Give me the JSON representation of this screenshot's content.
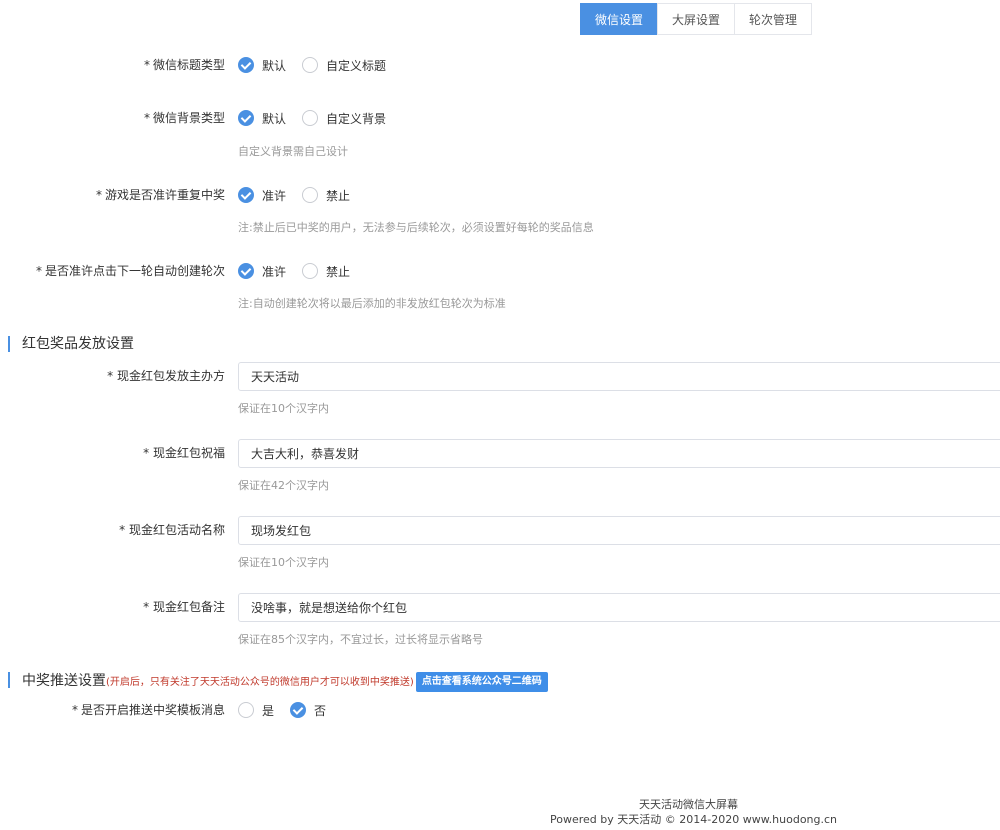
{
  "tabs": [
    {
      "label": "微信设置",
      "active": true
    },
    {
      "label": "大屏设置",
      "active": false
    },
    {
      "label": "轮次管理",
      "active": false
    }
  ],
  "settings": [
    {
      "label": "微信标题类型",
      "options": [
        "默认",
        "自定义标题"
      ],
      "selected": 0
    },
    {
      "label": "微信背景类型",
      "options": [
        "默认",
        "自定义背景"
      ],
      "selected": 0,
      "hint": "自定义背景需自己设计"
    },
    {
      "label": "游戏是否准许重复中奖",
      "options": [
        "准许",
        "禁止"
      ],
      "selected": 0,
      "hint": "注:禁止后已中奖的用户，无法参与后续轮次，必须设置好每轮的奖品信息"
    },
    {
      "label": "是否准许点击下一轮自动创建轮次",
      "options": [
        "准许",
        "禁止"
      ],
      "selected": 0,
      "hint": "注:自动创建轮次将以最后添加的非发放红包轮次为标准"
    }
  ],
  "redpacket": {
    "title": "红包奖品发放设置",
    "fields": [
      {
        "label": "现金红包发放主办方",
        "value": "天天活动",
        "hint": "保证在10个汉字内"
      },
      {
        "label": "现金红包祝福",
        "value": "大吉大利，恭喜发财",
        "hint": "保证在42个汉字内"
      },
      {
        "label": "现金红包活动名称",
        "value": "现场发红包",
        "hint": "保证在10个汉字内"
      },
      {
        "label": "现金红包备注",
        "value": "没啥事，就是想送给你个红包",
        "hint": "保证在85个汉字内，不宜过长，过长将显示省略号"
      }
    ]
  },
  "push": {
    "title": "中奖推送设置",
    "note": "(开启后，只有关注了天天活动公众号的微信用户才可以收到中奖推送)",
    "button": "点击查看系统公众号二维码",
    "setting": {
      "label": "是否开启推送中奖模板消息",
      "options": [
        "是",
        "否"
      ],
      "selected": 1
    }
  },
  "footer": {
    "line1": "天天活动微信大屏幕",
    "line2": "Powered by 天天活动 © 2014-2020 www.huodong.cn"
  },
  "colors": {
    "accent": "#4a90e2",
    "note": "#c0392b"
  }
}
